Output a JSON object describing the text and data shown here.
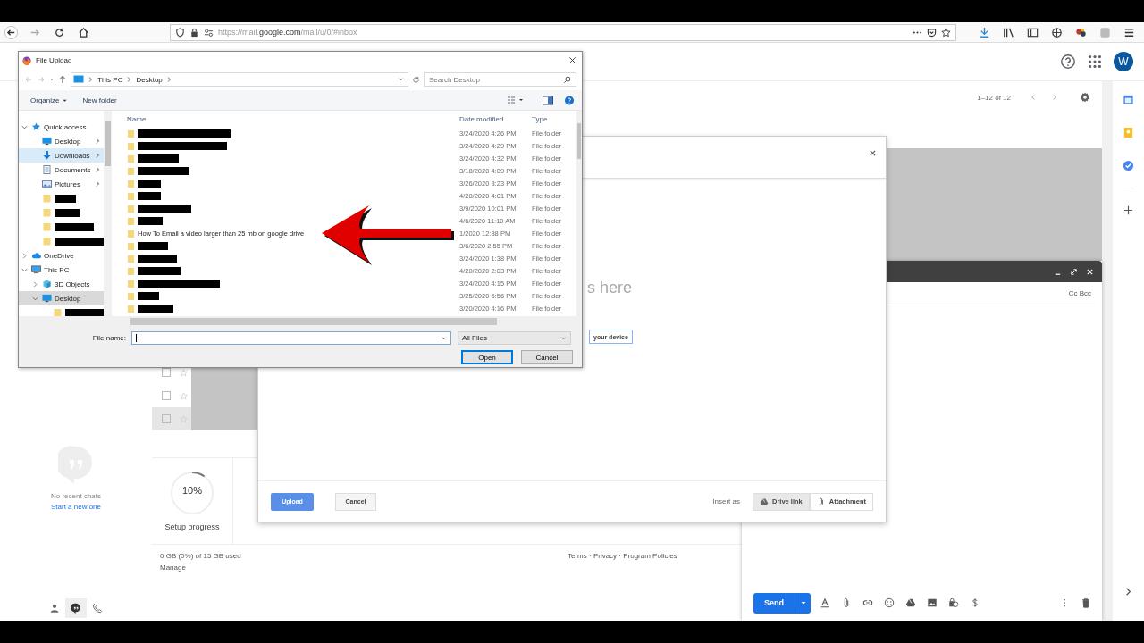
{
  "browser": {
    "url": "https://mail.**google.com**/mail/u/0/#inbox"
  },
  "gmail": {
    "avatar": "W",
    "pagination": "1–12 of 12",
    "rows": [
      {
        "checked": false,
        "hovered": false
      },
      {
        "checked": false,
        "hovered": false
      },
      {
        "checked": false,
        "hovered": true
      }
    ],
    "setup": {
      "percent": "10%",
      "level": 0.1,
      "label": "Setup progress"
    },
    "storage": {
      "usage": "0 GB (0%) of 15 GB used",
      "manage": "Manage"
    },
    "footer": "Terms · Privacy · Program Policies",
    "chat": {
      "empty": "No recent chats",
      "link": "Start a new one"
    }
  },
  "compose": {
    "cc_bcc": "Cc Bcc",
    "send": "Send"
  },
  "picker": {
    "drop_hint": "s here",
    "device_button": "your device",
    "upload": {
      "label": "Upload",
      "disabled": true
    },
    "cancel": "Cancel",
    "insert_label": "Insert as",
    "insert_options": [
      {
        "label": "Drive link",
        "kind": "drive",
        "selected": true
      },
      {
        "label": "Attachment",
        "kind": "attachment",
        "selected": false
      }
    ]
  },
  "file_dialog": {
    "title": "File Upload",
    "breadcrumb": [
      "This PC",
      "Desktop"
    ],
    "search_placeholder": "Search Desktop",
    "organize": "Organize",
    "new_folder": "New folder",
    "nav": [
      {
        "label": "Quick access",
        "kind": "star",
        "expanded": true,
        "selected": false,
        "hovered": false,
        "children": [
          {
            "label": "Desktop",
            "kind": "desktop",
            "redacted": false,
            "pinned": true,
            "selected": false,
            "hovered": false
          },
          {
            "label": "Downloads",
            "kind": "download",
            "redacted": false,
            "pinned": true,
            "selected": false,
            "hovered": true
          },
          {
            "label": "Documents",
            "kind": "document",
            "redacted": false,
            "pinned": true,
            "selected": false,
            "hovered": false
          },
          {
            "label": "Pictures",
            "kind": "pictures",
            "redacted": false,
            "pinned": true,
            "selected": false,
            "hovered": false
          },
          {
            "kind": "folder",
            "redacted": true,
            "pinned": false,
            "selected": false,
            "hovered": false
          },
          {
            "kind": "folder",
            "redacted": true,
            "pinned": false,
            "selected": false,
            "hovered": false
          },
          {
            "kind": "folder",
            "redacted": true,
            "pinned": false,
            "selected": false,
            "hovered": false
          },
          {
            "kind": "folder",
            "redacted": true,
            "pinned": false,
            "selected": false,
            "hovered": false
          }
        ]
      },
      {
        "label": "OneDrive",
        "kind": "cloud",
        "expanded": false,
        "selected": false,
        "hovered": false
      },
      {
        "label": "This PC",
        "kind": "pc",
        "expanded": true,
        "selected": false,
        "hovered": false,
        "children": [
          {
            "label": "3D Objects",
            "kind": "cube",
            "expanded": false,
            "selected": false,
            "hovered": false
          },
          {
            "label": "Desktop",
            "kind": "desktop",
            "expanded": true,
            "selected": true,
            "hovered": false,
            "children": [
              {
                "kind": "folder",
                "redacted": true,
                "selected": false,
                "hovered": false
              }
            ]
          }
        ]
      }
    ],
    "columns": [
      "Name",
      "Date modified",
      "Type"
    ],
    "files": [
      {
        "redacted": true,
        "date": "3/24/2020 4:26 PM",
        "type": "File folder"
      },
      {
        "redacted": true,
        "date": "3/24/2020 4:29 PM",
        "type": "File folder"
      },
      {
        "redacted": true,
        "date": "3/24/2020 4:32 PM",
        "type": "File folder"
      },
      {
        "redacted": true,
        "date": "3/18/2020 4:09 PM",
        "type": "File folder"
      },
      {
        "redacted": true,
        "date": "3/26/2020 3:23 PM",
        "type": "File folder"
      },
      {
        "redacted": true,
        "date": "4/20/2020 4:01 PM",
        "type": "File folder"
      },
      {
        "redacted": true,
        "date": "3/9/2020 10:01 PM",
        "type": "File folder"
      },
      {
        "redacted": true,
        "date": "4/6/2020 11:10 AM",
        "type": "File folder"
      },
      {
        "redacted": false,
        "name": "How To Email a video larger than 25 mb on google drive",
        "date": "1/2020 12:38 PM",
        "type": "File folder"
      },
      {
        "redacted": true,
        "date": "3/6/2020 2:55 PM",
        "type": "File folder"
      },
      {
        "redacted": true,
        "date": "3/24/2020 1:38 PM",
        "type": "File folder"
      },
      {
        "redacted": true,
        "date": "4/20/2020 2:03 PM",
        "type": "File folder"
      },
      {
        "redacted": true,
        "date": "3/24/2020 4:15 PM",
        "type": "File folder"
      },
      {
        "redacted": true,
        "date": "3/25/2020 5:56 PM",
        "type": "File folder"
      },
      {
        "redacted": true,
        "date": "3/20/2020 4:16 PM",
        "type": "File folder"
      }
    ],
    "file_name_label": "File name:",
    "file_type": "All Files",
    "open": "Open",
    "cancel": "Cancel"
  }
}
